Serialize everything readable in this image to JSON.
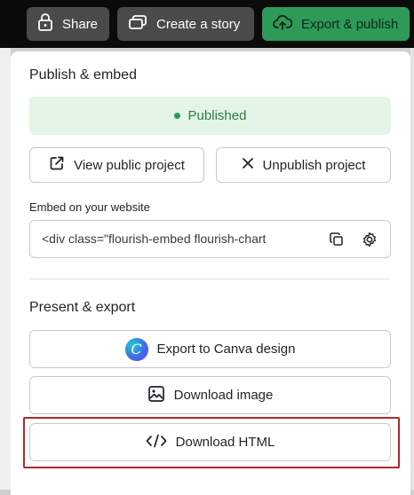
{
  "topbar": {
    "share_label": "Share",
    "story_label": "Create a story",
    "export_label": "Export & publish"
  },
  "publish": {
    "title": "Publish & embed",
    "status": "Published",
    "view_label": "View public project",
    "unpublish_label": "Unpublish project"
  },
  "embed": {
    "label": "Embed on your website",
    "code": "<div class=\"flourish-embed flourish-chart"
  },
  "present": {
    "title": "Present & export",
    "canva_label": "Export to Canva design",
    "image_label": "Download image",
    "html_label": "Download HTML"
  },
  "icons": {
    "share": "lock-share-icon",
    "story": "story-slides-icon",
    "export": "cloud-upload-icon",
    "view": "external-link-icon",
    "unpublish": "close-icon",
    "copy": "copy-icon",
    "settings": "gear-icon",
    "canva": "canva-logo",
    "image": "image-icon",
    "html": "code-icon"
  },
  "colors": {
    "accent_green": "#2e9a58",
    "published_bg": "#e3f5e6",
    "highlight_red": "#b3262b"
  }
}
